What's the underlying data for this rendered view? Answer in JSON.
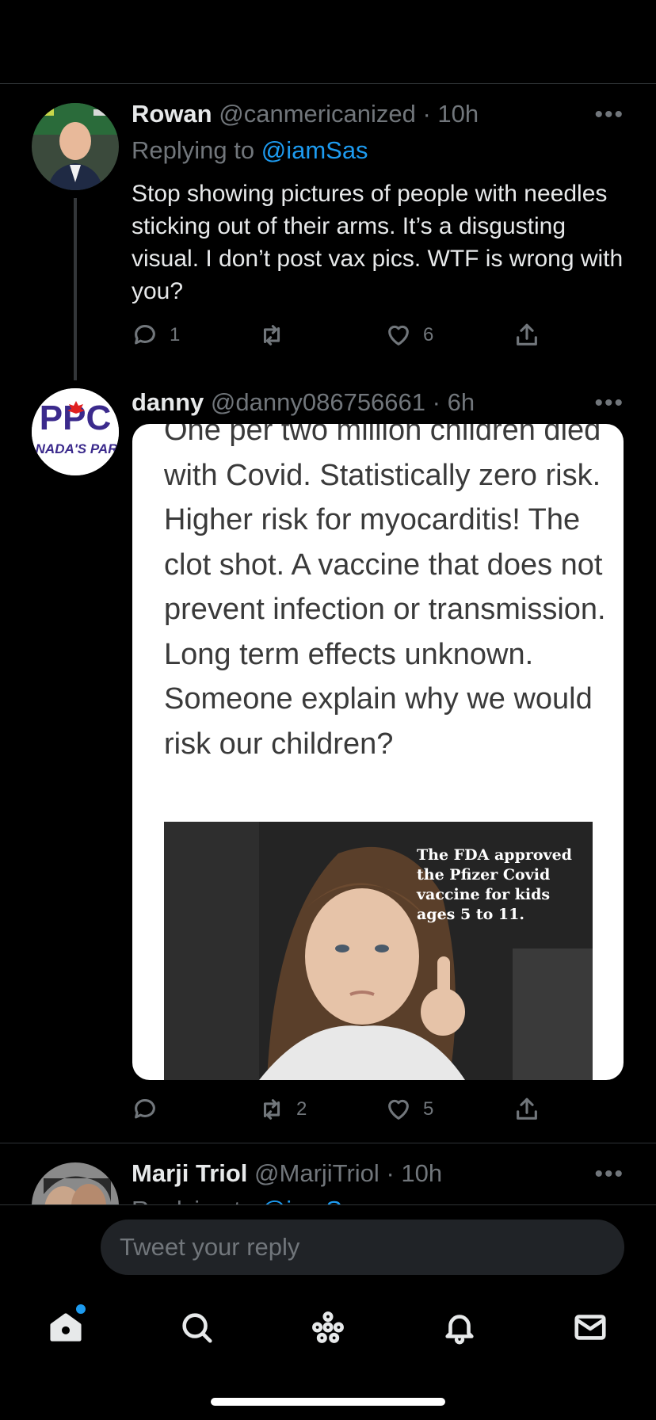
{
  "tweets": [
    {
      "name": "Rowan",
      "handle": "@canmericanized",
      "dot": "·",
      "time": "10h",
      "replying_prefix": "Replying to ",
      "replying_to": "@iamSas",
      "text": "Stop showing pictures of people with needles sticking out of their arms. It’s a disgusting visual. I don’t post vax pics. WTF is wrong with you?",
      "reply_count": "1",
      "retweet_count": "",
      "like_count": "6"
    },
    {
      "name": "danny",
      "handle": "@danny086756661",
      "dot": "·",
      "time": "6h",
      "avatar_text": "PPC",
      "avatar_sub": "CANADA'S PARTY",
      "image_text": "One per two million children died with Covid. Statistically zero risk. Higher risk for myocarditis! The clot shot. A vaccine that does not prevent infection or transmission. Long term effects unknown. Someone explain why we would risk our children?",
      "image_caption": "The FDA approved the Pfizer Covid vaccine for kids ages 5 to 11.",
      "reply_count": "",
      "retweet_count": "2",
      "like_count": "5"
    },
    {
      "name": "Marji Triol",
      "handle": "@MarjiTriol",
      "dot": "·",
      "time": "10h",
      "replying_prefix": "Replying to ",
      "replying_to": "@iamSas"
    }
  ],
  "more_label": "•••",
  "reply": {
    "placeholder": "Tweet your reply"
  },
  "tabs": [
    "home",
    "search",
    "spaces",
    "notifications",
    "messages"
  ],
  "colors": {
    "background": "#000000",
    "accent": "#1d9bf0",
    "muted": "#71767b"
  }
}
